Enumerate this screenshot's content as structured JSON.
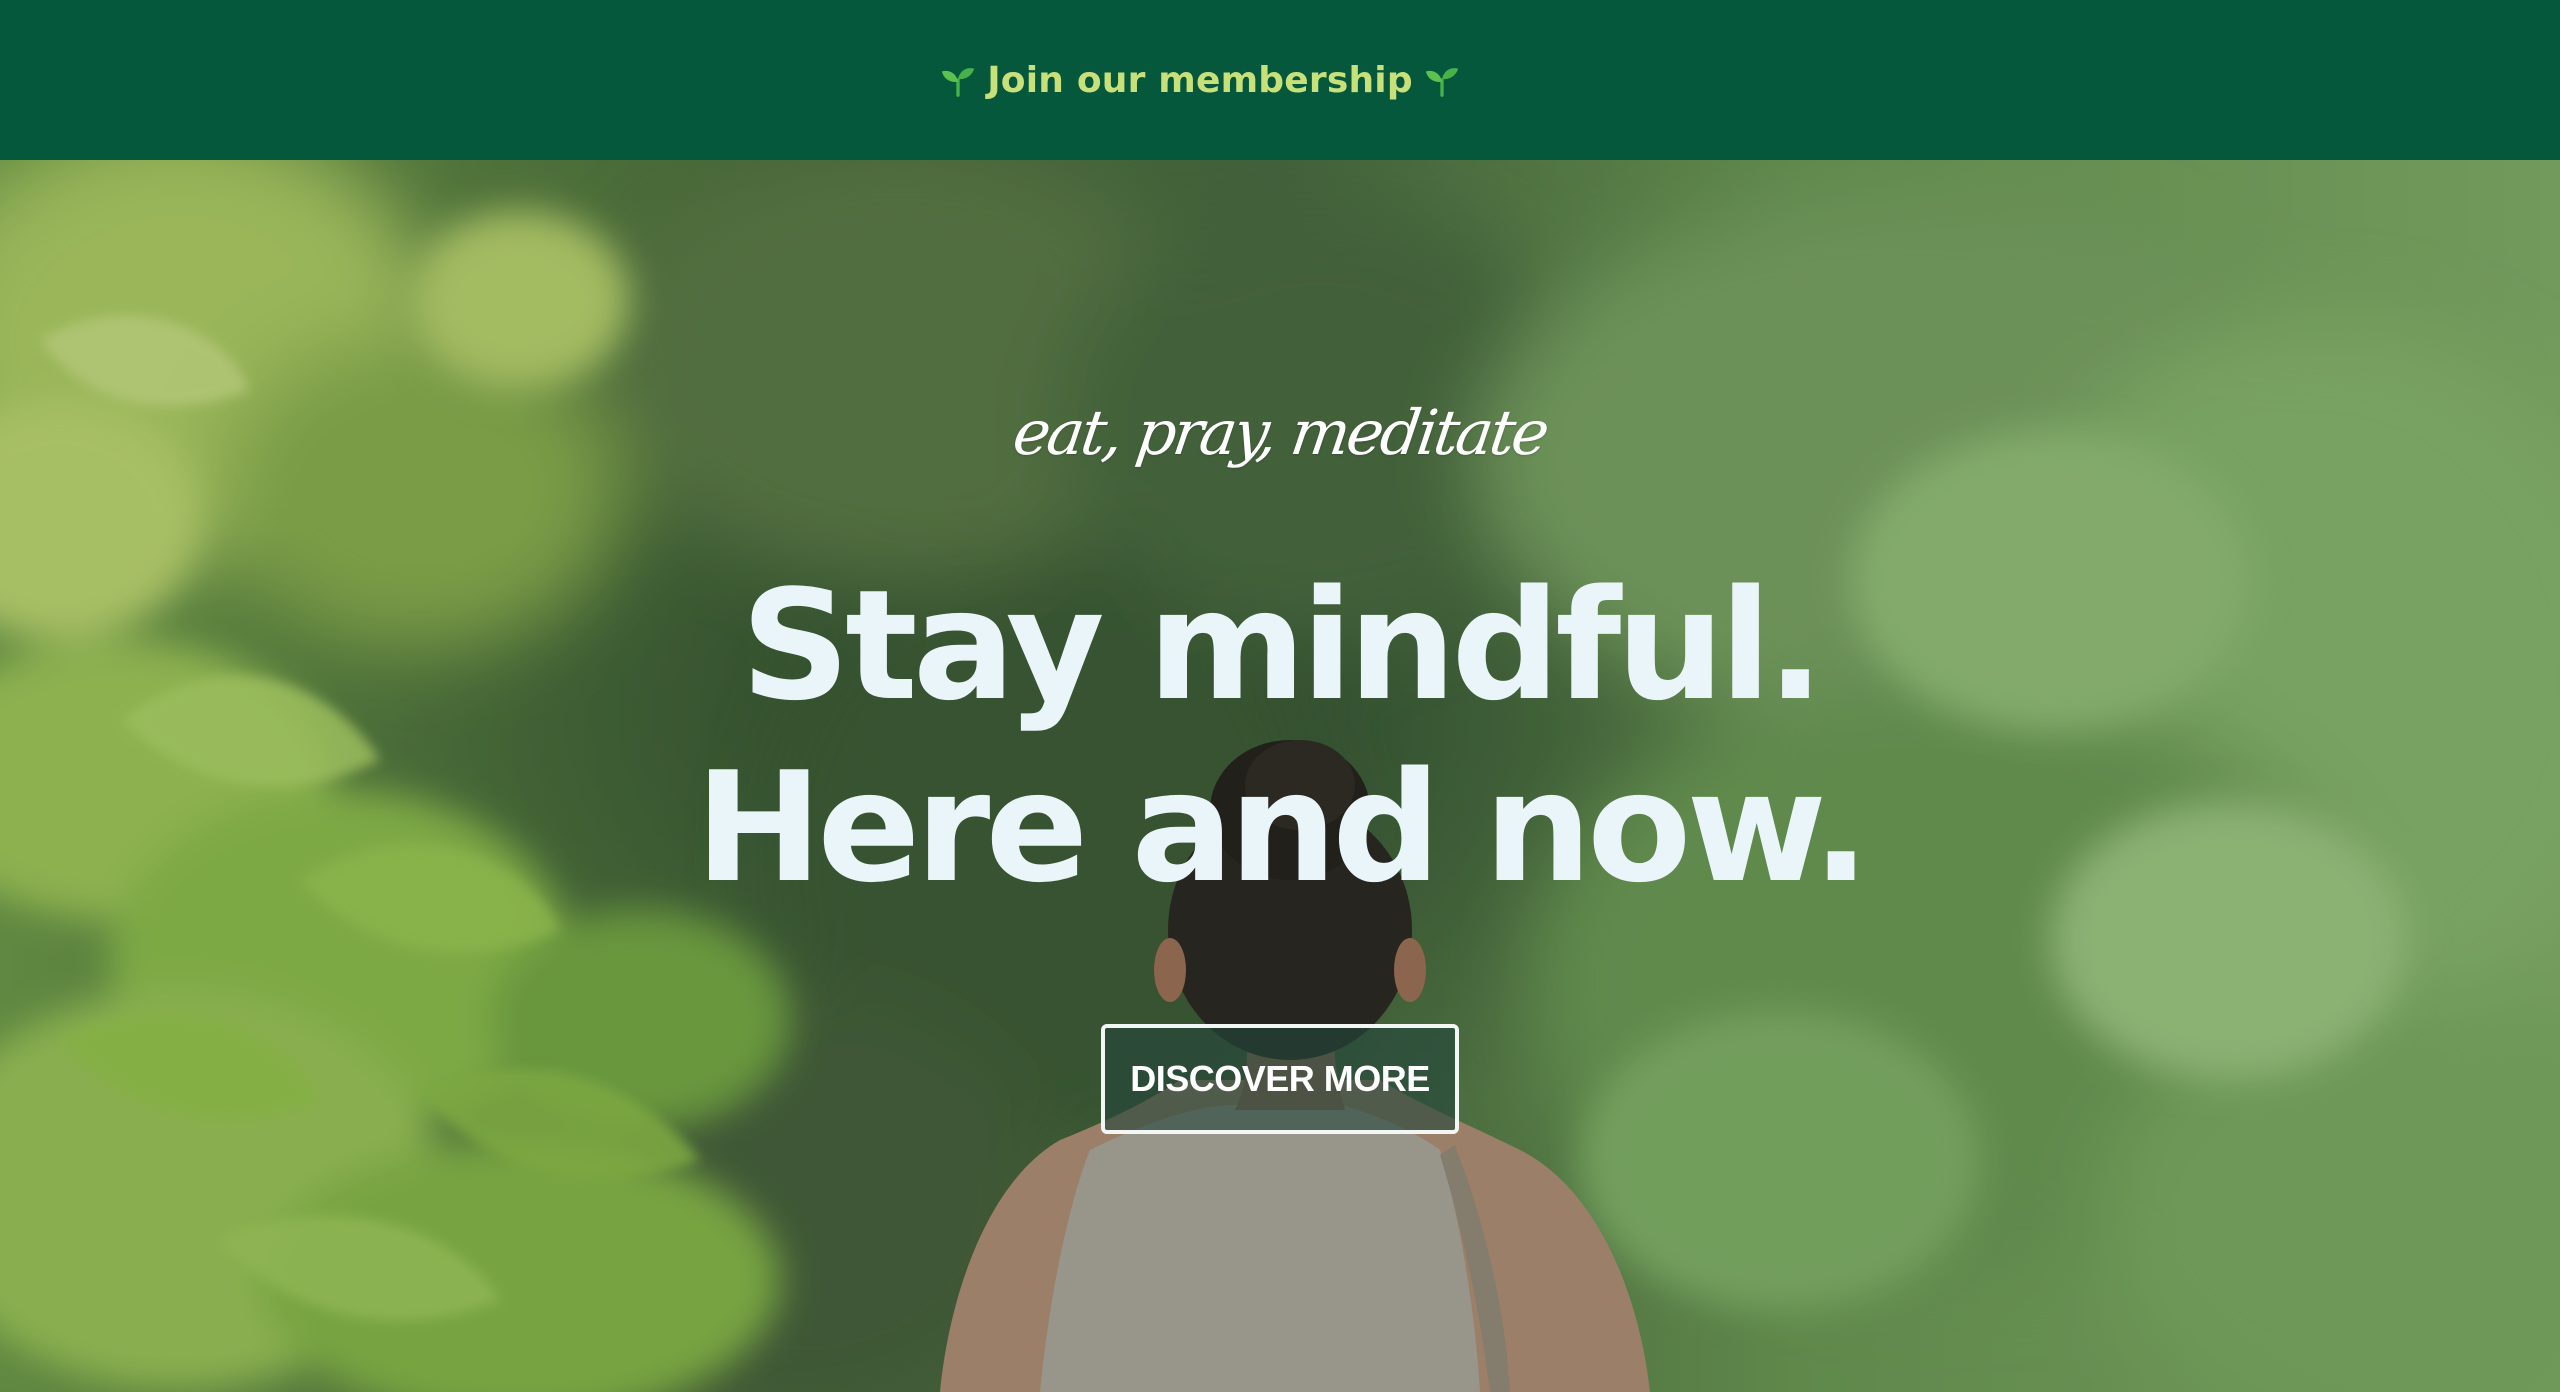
{
  "announcement": {
    "label": "Join our membership",
    "icon_left": "sprout-icon",
    "icon_right": "sprout-icon",
    "background": "#06583d",
    "text_color": "#c7e07a"
  },
  "hero": {
    "tagline": "eat, pray, meditate",
    "headline_line1": "Stay mindful.",
    "headline_line2": "Here and now.",
    "cta_label": "DISCOVER MORE",
    "background_image": "blurred forest with woman seen from behind"
  },
  "colors": {
    "brand_green": "#06583d",
    "accent_lime": "#c7e07a",
    "headline": "#e9f5f8"
  }
}
